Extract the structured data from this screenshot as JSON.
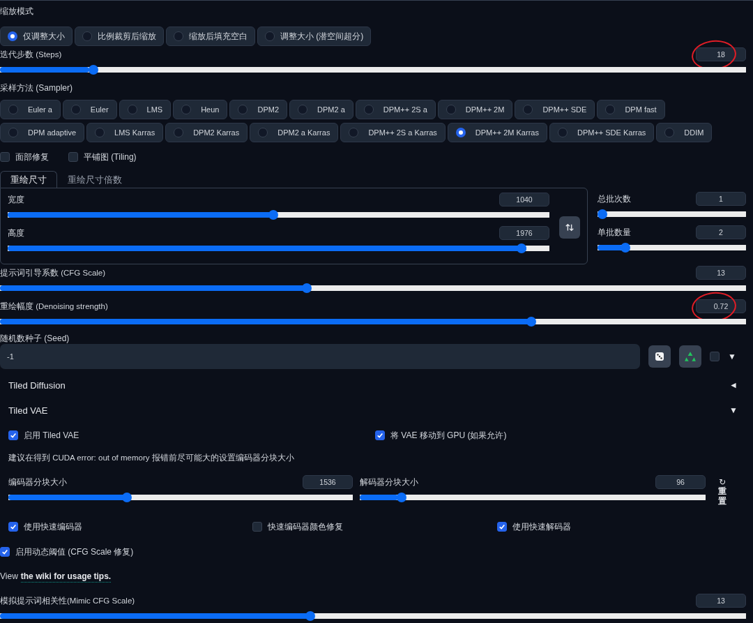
{
  "resize_mode": {
    "label": "缩放模式",
    "options": [
      {
        "label": "仅调整大小",
        "selected": true
      },
      {
        "label": "比例裁剪后缩放",
        "selected": false
      },
      {
        "label": "缩放后填充空白",
        "selected": false
      },
      {
        "label": "调整大小 (潜空间超分)",
        "selected": false
      }
    ]
  },
  "steps": {
    "label": "迭代步数 (Steps)",
    "value": "18",
    "level": 0.12,
    "circled": true
  },
  "sampler": {
    "label": "采样方法 (Sampler)",
    "options": [
      {
        "label": "Euler a",
        "selected": false
      },
      {
        "label": "Euler",
        "selected": false
      },
      {
        "label": "LMS",
        "selected": false
      },
      {
        "label": "Heun",
        "selected": false
      },
      {
        "label": "DPM2",
        "selected": false
      },
      {
        "label": "DPM2 a",
        "selected": false
      },
      {
        "label": "DPM++ 2S a",
        "selected": false
      },
      {
        "label": "DPM++ 2M",
        "selected": false
      },
      {
        "label": "DPM++ SDE",
        "selected": false
      },
      {
        "label": "DPM fast",
        "selected": false
      },
      {
        "label": "DPM adaptive",
        "selected": false
      },
      {
        "label": "LMS Karras",
        "selected": false
      },
      {
        "label": "DPM2 Karras",
        "selected": false
      },
      {
        "label": "DPM2 a Karras",
        "selected": false
      },
      {
        "label": "DPM++ 2S a Karras",
        "selected": false
      },
      {
        "label": "DPM++ 2M Karras",
        "selected": true
      },
      {
        "label": "DPM++ SDE Karras",
        "selected": false
      },
      {
        "label": "DDIM",
        "selected": false
      }
    ]
  },
  "options": [
    {
      "label": "面部修复",
      "checked": false
    },
    {
      "label": "平铺图 (Tiling)",
      "checked": false
    }
  ],
  "size_tabs": [
    {
      "label": "重绘尺寸",
      "selected": true
    },
    {
      "label": "重绘尺寸倍数",
      "selected": false
    }
  ],
  "width": {
    "label": "宽度",
    "value": "1040",
    "level": 0.49,
    "circled": false
  },
  "height": {
    "label": "高度",
    "value": "1976",
    "level": 0.957,
    "circled": false
  },
  "batch_count": {
    "label": "总批次数",
    "value": "1",
    "level": 0,
    "circled": false
  },
  "batch_size": {
    "label": "单批数量",
    "value": "2",
    "level": 0.167,
    "circled": false
  },
  "cfg_scale": {
    "label": "提示词引导系数 (CFG Scale)",
    "value": "13",
    "level": 0.41,
    "circled": false
  },
  "denoising": {
    "label": "重绘幅度 (Denoising strength)",
    "value": "0.72",
    "level": 0.715,
    "circled": true
  },
  "seed": {
    "label": "随机数种子 (Seed)",
    "value": "-1",
    "extra_checked": false,
    "arrow": "▼"
  },
  "accordions": [
    {
      "title": "Tiled Diffusion",
      "arrow": "◄"
    },
    {
      "title": "Tiled VAE",
      "arrow": "▼"
    }
  ],
  "tiled_vae": {
    "toggles": [
      {
        "label": "启用 Tiled VAE",
        "checked": true
      },
      {
        "label": "将 VAE 移动到 GPU (如果允许)",
        "checked": true
      }
    ],
    "note": "建议在得到 CUDA error: out of memory 报错前尽可能大的设置编码器分块大小",
    "encoder": {
      "label": "编码器分块大小",
      "value": "1536",
      "level": 0.34,
      "circled": false
    },
    "decoder": {
      "label": "解码器分块大小",
      "value": "96",
      "level": 0.11,
      "circled": false
    },
    "reset": {
      "icon": "↻",
      "label": "重置"
    },
    "fast_options": [
      {
        "label": "使用快速编码器",
        "checked": true
      },
      {
        "label": "快速编码器颜色修复",
        "checked": false
      },
      {
        "label": "使用快速解码器",
        "checked": true
      }
    ]
  },
  "dynamic_threshold": {
    "label": "启用动态阈值 (CFG Scale 修复)",
    "checked": true
  },
  "wiki": {
    "prefix": "View",
    "link": "the wiki for usage tips."
  },
  "mimic": {
    "label": "模拟提示词相关性(Mimic CFG Scale)",
    "value": "13",
    "level": 0.415,
    "circled": false
  }
}
